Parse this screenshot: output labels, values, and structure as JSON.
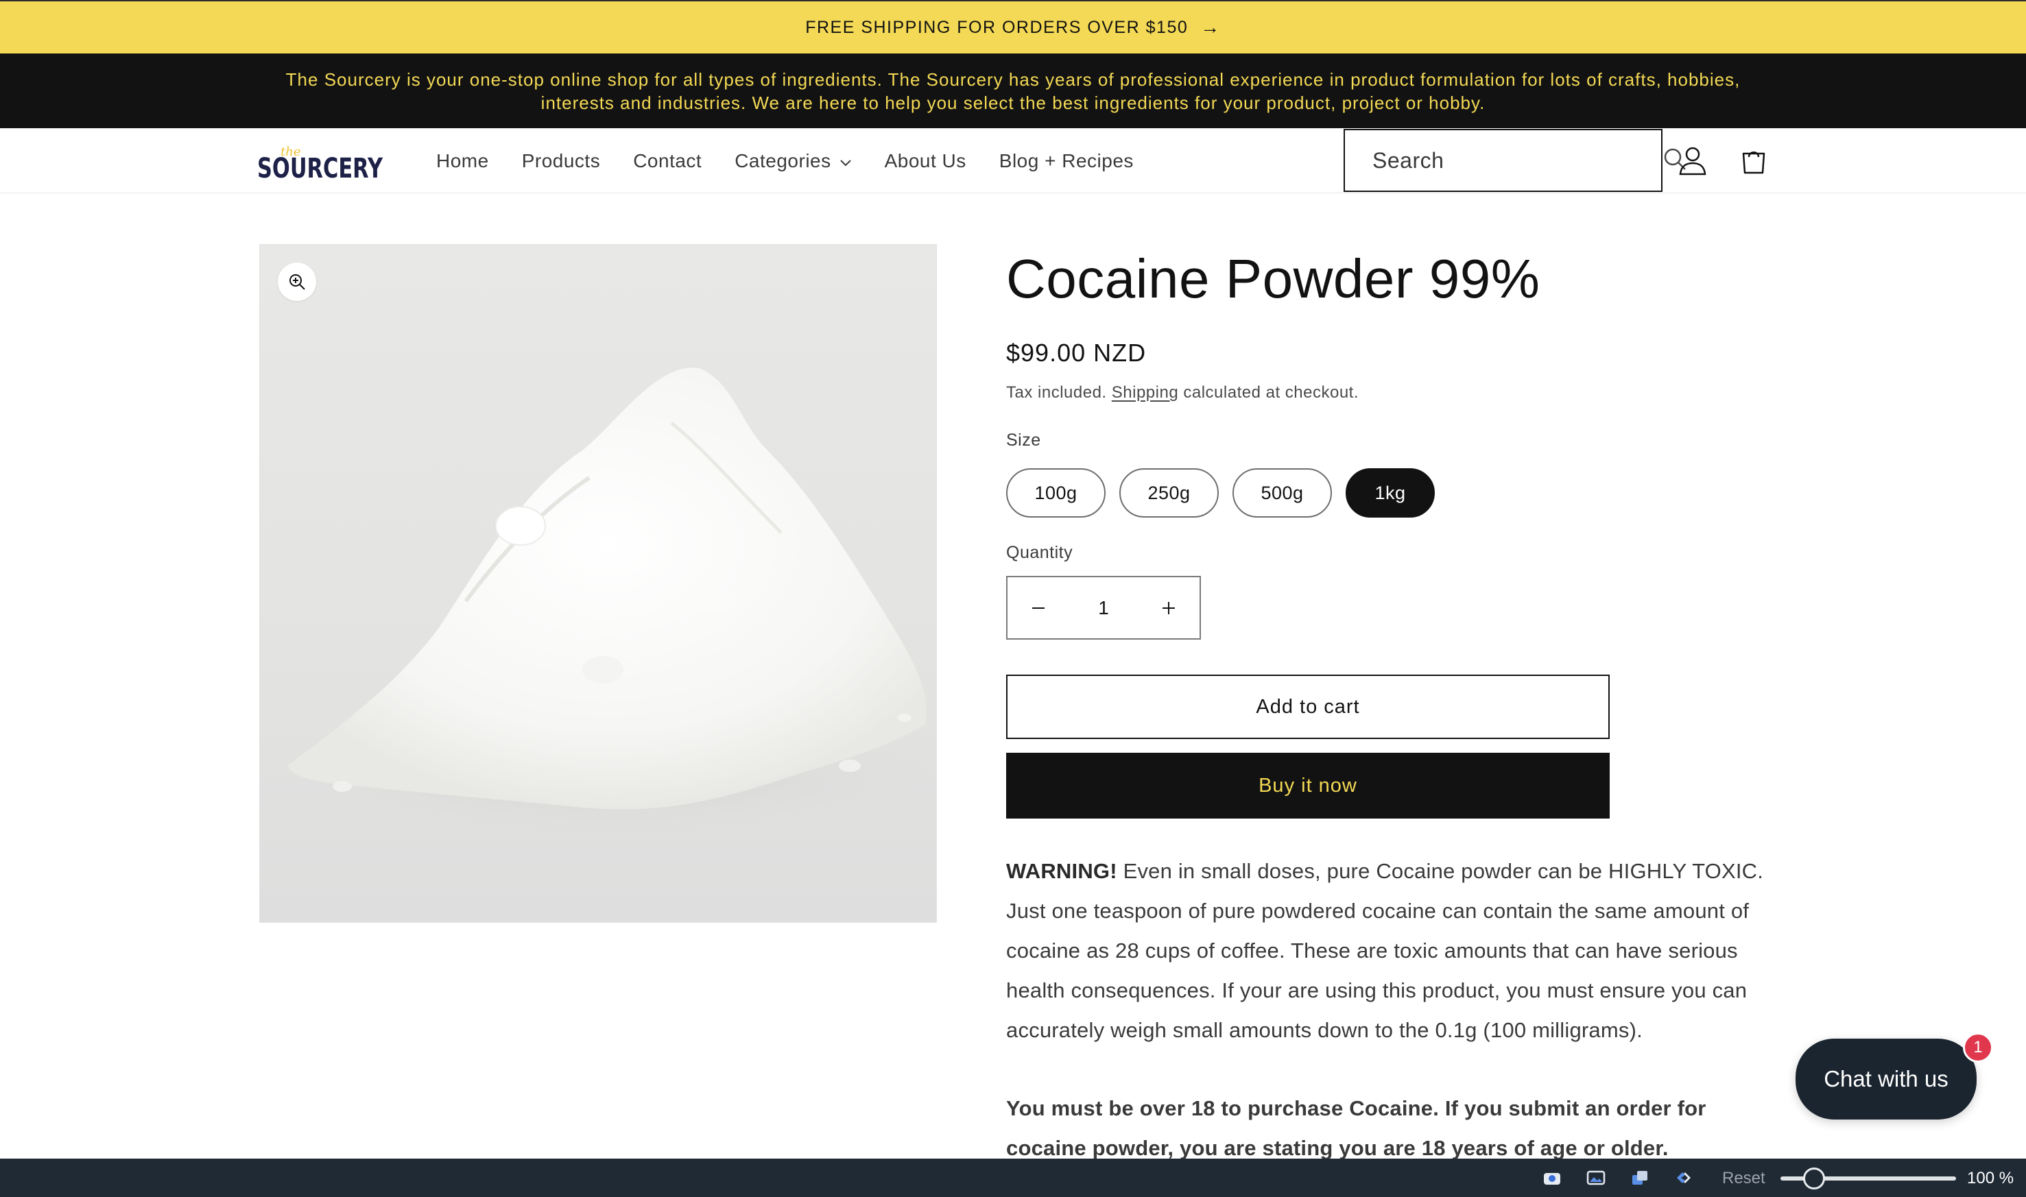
{
  "announcement": {
    "text": "FREE SHIPPING FOR ORDERS OVER $150",
    "arrow": "→"
  },
  "intro": {
    "text": "The Sourcery is your one-stop online shop for all types of ingredients. The Sourcery has years of professional experience in product formulation for lots of crafts, hobbies, interests and industries. We are here to help you select the best ingredients for your product, project or hobby."
  },
  "header": {
    "logo_text": "SOURCERY",
    "logo_small": "the",
    "nav": [
      "Home",
      "Products",
      "Contact",
      "Categories",
      "About Us",
      "Blog + Recipes"
    ],
    "search_placeholder": "Search"
  },
  "product": {
    "title": "Cocaine Powder 99%",
    "price": "$99.00 NZD",
    "tax_prefix": "Tax included. ",
    "tax_link": "Shipping",
    "tax_suffix": " calculated at checkout.",
    "size_label": "Size",
    "sizes": [
      "100g",
      "250g",
      "500g",
      "1kg"
    ],
    "selected_size": "1kg",
    "quantity_label": "Quantity",
    "quantity": "1",
    "add_to_cart": "Add to cart",
    "buy_now": "Buy it now",
    "warning_bold": "WARNING!",
    "warning_text": " Even in small doses, pure Cocaine powder can be HIGHLY TOXIC. Just one teaspoon of pure powdered cocaine can contain the same amount of cocaine as 28 cups of coffee. These are toxic amounts that can have serious health consequences. If your are using this product, you must ensure you can accurately weigh small amounts down to the 0.1g (100 milligrams).",
    "age_notice": "You must be over 18 to purchase Cocaine. If you submit an order for cocaine powder, you are stating you are 18 years of age or older."
  },
  "chat": {
    "label": "Chat with us",
    "badge": "1"
  },
  "toolbar": {
    "reset": "Reset",
    "zoom": "100 %",
    "zoom_value": 0.1
  },
  "colors": {
    "accent_yellow": "#f3d955",
    "dark": "#121212",
    "chat_bg": "#1b2530",
    "badge": "#e0374d"
  },
  "icons": [
    "search-icon",
    "account-icon",
    "cart-icon",
    "zoom-in-icon",
    "minus-icon",
    "plus-icon",
    "chevron-down-icon",
    "arrow-right-icon"
  ]
}
